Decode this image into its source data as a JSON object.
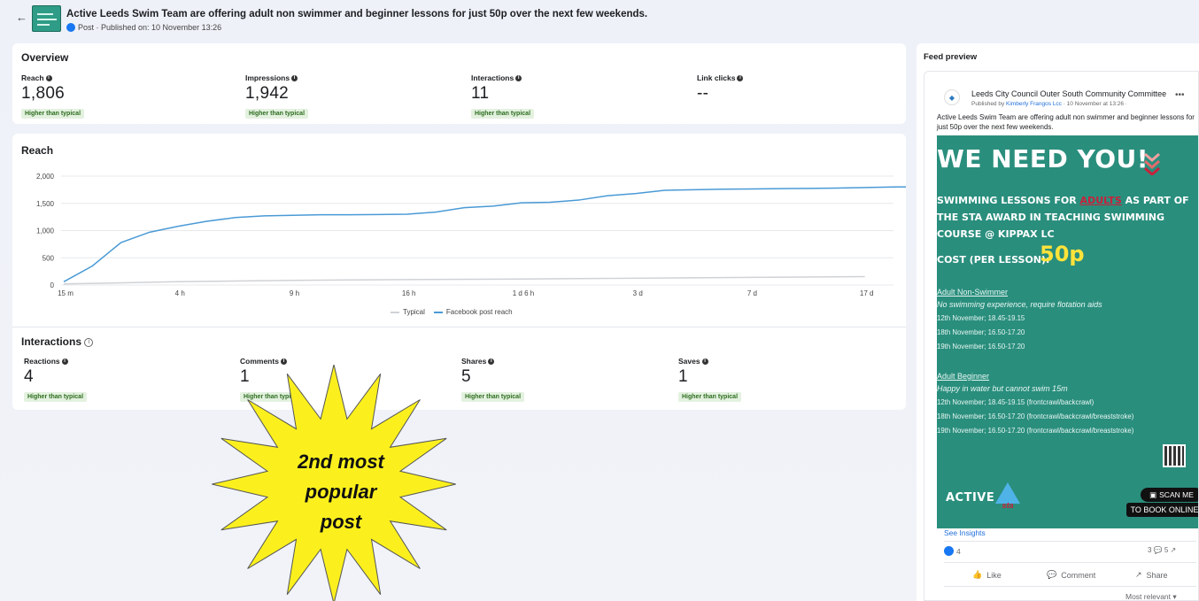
{
  "header": {
    "back_label": "←",
    "post_title": "Active Leeds Swim Team are offering adult non swimmer and beginner lessons for just 50p over the next few weekends.",
    "post_meta": "Post · Published on: 10 November 13:26"
  },
  "overview": {
    "title": "Overview",
    "metrics": [
      {
        "label": "Reach",
        "value": "1,806",
        "badge": "Higher than typical"
      },
      {
        "label": "Impressions",
        "value": "1,942",
        "badge": "Higher than typical"
      },
      {
        "label": "Interactions",
        "value": "11",
        "badge": "Higher than typical"
      },
      {
        "label": "Link clicks",
        "value": "--",
        "badge": ""
      }
    ]
  },
  "reach_chart": {
    "title": "Reach",
    "legend": {
      "typical": "Typical",
      "post": "Facebook post reach"
    }
  },
  "chart_data": {
    "type": "line",
    "title": "Reach",
    "x_ticks": [
      "15 m",
      "4 h",
      "9 h",
      "16 h",
      "1 d 6 h",
      "3 d",
      "7 d",
      "17 d"
    ],
    "y_ticks": [
      "0",
      "500",
      "1,000",
      "1,500",
      "2,000"
    ],
    "ylim": [
      0,
      2000
    ],
    "legend_placement": "bottom",
    "series": [
      {
        "name": "Typical",
        "color": "#cfd2d6",
        "x": [
          0,
          1,
          2,
          3,
          4,
          5,
          6,
          7
        ],
        "values": [
          20,
          60,
          85,
          100,
          110,
          125,
          140,
          155
        ]
      },
      {
        "name": "Facebook post reach",
        "color": "#4a9ad6",
        "x": [
          0,
          0.25,
          0.5,
          0.75,
          1,
          1.25,
          1.5,
          1.75,
          2,
          2.25,
          2.5,
          2.75,
          3,
          3.25,
          3.5,
          3.75,
          4,
          4.25,
          4.5,
          4.75,
          5,
          5.25,
          5.5,
          5.75,
          6,
          6.25,
          6.5,
          6.75,
          7,
          7.25,
          7.45
        ],
        "values": [
          60,
          350,
          780,
          970,
          1080,
          1170,
          1240,
          1270,
          1280,
          1290,
          1290,
          1295,
          1300,
          1340,
          1420,
          1450,
          1510,
          1520,
          1560,
          1640,
          1680,
          1740,
          1750,
          1760,
          1765,
          1770,
          1775,
          1780,
          1790,
          1800,
          1806
        ]
      }
    ]
  },
  "interactions": {
    "title": "Interactions",
    "metrics": [
      {
        "label": "Reactions",
        "value": "4",
        "badge": "Higher than typical"
      },
      {
        "label": "Comments",
        "value": "1",
        "badge": "Higher than typical"
      },
      {
        "label": "Shares",
        "value": "5",
        "badge": "Higher than typical"
      },
      {
        "label": "Saves",
        "value": "1",
        "badge": "Higher than typical"
      }
    ]
  },
  "callout": {
    "text_lines": [
      "2nd most",
      "popular",
      "post"
    ],
    "color": "#fbf01d"
  },
  "feed_preview": {
    "title": "Feed preview",
    "page_name": "Leeds City Council Outer South Community Committee",
    "published_prefix": "Published by ",
    "published_by": "Kimberly Frangos Lcc",
    "published_suffix": " · 10 November at 13:26 ·",
    "body": "Active Leeds Swim Team are offering adult non swimmer and beginner lessons for just 50p over the next few weekends.",
    "poster": {
      "headline": "WE NEED YOU!",
      "sub_before": "SWIMMING LESSONS FOR ",
      "sub_highlight": "ADULTS",
      "sub_after": " AS PART OF THE STA AWARD IN TEACHING SWIMMING COURSE @ KIPPAX LC",
      "cost_label": "COST (PER LESSON):",
      "cost_value": "50p",
      "section1_heading": "Adult Non-Swimmer",
      "section1_subtitle": "No swimming experience, require flotation aids",
      "section1_lines": [
        "12th November; 18.45-19.15",
        "18th November; 16.50-17.20",
        "19th November; 16.50-17.20"
      ],
      "section2_heading": "Adult Beginner",
      "section2_subtitle": "Happy in water but cannot swim 15m",
      "section2_lines": [
        "12th November; 18.45-19.15 (frontcrawl/backcrawl)",
        "18th November; 16.50-17.20 (frontcrawl/backcrawl/breaststroke)",
        "19th November; 16.50-17.20 (frontcrawl/backcrawl/breaststroke)"
      ],
      "scan_label": "SCAN ME",
      "book_label": "TO BOOK ONLINE",
      "logo_active": "ACTIVE",
      "logo_sta": "sta"
    },
    "see_insights": "See Insights",
    "reaction_count": "4",
    "comment_share_counts": "3 💬  5 ↗",
    "actions": {
      "like": "Like",
      "comment": "Comment",
      "share": "Share"
    },
    "sort_label": "Most relevant ▾"
  }
}
